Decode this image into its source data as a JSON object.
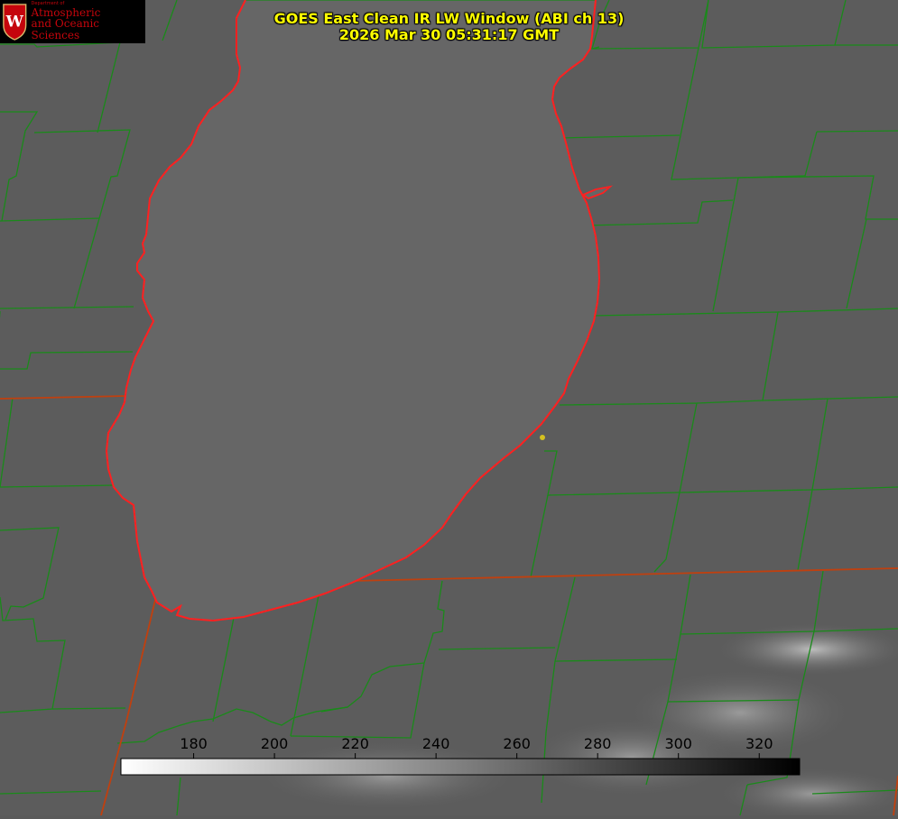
{
  "logo": {
    "department": "Department of",
    "line1": "Atmospheric",
    "line2": "and Oceanic Sciences",
    "crest_letter": "W"
  },
  "title": {
    "line1": "GOES East Clean IR LW Window (ABI ch 13)",
    "line2": "2026 Mar 30 05:31:17 GMT"
  },
  "colorbar": {
    "ticks": [
      "180",
      "200",
      "220",
      "240",
      "260",
      "280",
      "300",
      "320"
    ],
    "min_value": 162,
    "max_value": 330,
    "colors": {
      "low": "#ffffff",
      "high": "#000000"
    }
  },
  "colors": {
    "background": "#5a5a5a",
    "lake": "#666666",
    "lake_outline": "#ff2020",
    "county_lines": "#1a8a1a",
    "state_lines": "#c0400f",
    "title": "#ffff00",
    "marker": "#d4c020"
  }
}
